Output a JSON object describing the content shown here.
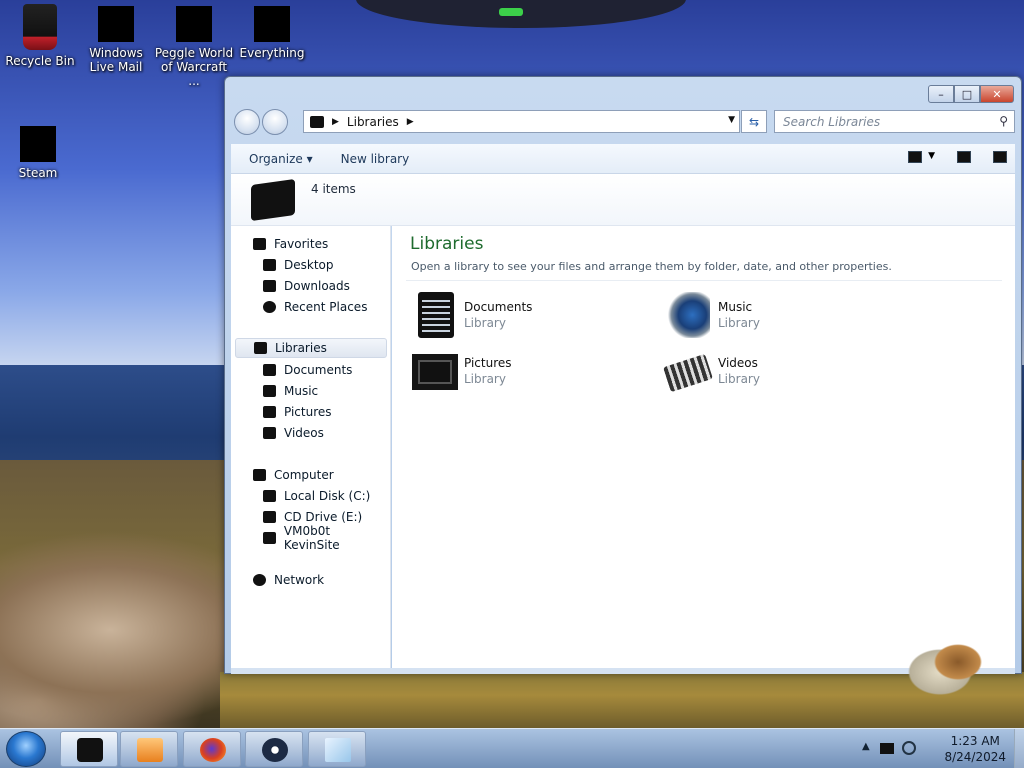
{
  "desktop": {
    "icons": [
      {
        "label": "Recycle Bin"
      },
      {
        "label": "Windows Live Mail"
      },
      {
        "label": "Peggle World of Warcraft ..."
      },
      {
        "label": "Everything"
      },
      {
        "label": "Steam"
      }
    ]
  },
  "window": {
    "caption": {
      "minimize": "–",
      "maximize": "□",
      "close": "✕"
    },
    "address": {
      "path_item": "Libraries"
    },
    "search": {
      "placeholder": "Search Libraries"
    },
    "toolbar": {
      "organize": "Organize ▾",
      "new_library": "New library"
    },
    "details": {
      "count": "4 items"
    },
    "nav": {
      "favorites": "Favorites",
      "desktop": "Desktop",
      "downloads": "Downloads",
      "recent_places": "Recent Places",
      "libraries": "Libraries",
      "documents": "Documents",
      "music": "Music",
      "pictures": "Pictures",
      "videos": "Videos",
      "computer": "Computer",
      "local_disk": "Local Disk (C:)",
      "cd_drive": "CD Drive (E:)",
      "vm_share": "VM0b0t KevinSite",
      "network": "Network"
    },
    "content": {
      "title": "Libraries",
      "subtitle": "Open a library to see your files and arrange them by folder, date, and other properties.",
      "libraries": [
        {
          "name": "Documents",
          "type": "Library"
        },
        {
          "name": "Music",
          "type": "Library"
        },
        {
          "name": "Pictures",
          "type": "Library"
        },
        {
          "name": "Videos",
          "type": "Library"
        }
      ]
    }
  },
  "taskbar": {
    "clock": {
      "time": "1:23 AM",
      "date": "8/24/2024"
    }
  }
}
